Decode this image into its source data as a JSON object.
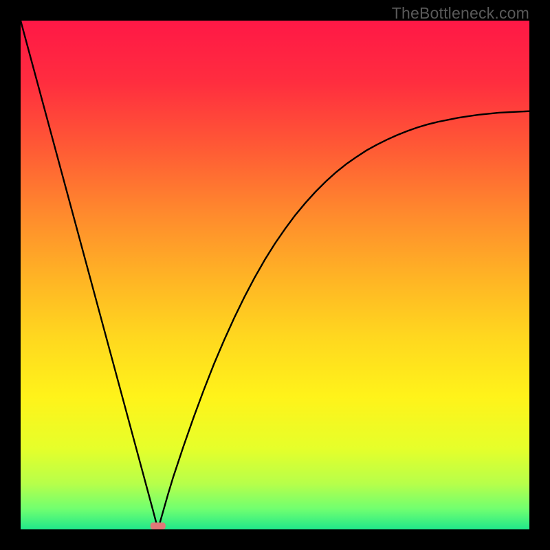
{
  "watermark": "TheBottleneck.com",
  "chart_data": {
    "type": "line",
    "title": "",
    "xlabel": "",
    "ylabel": "",
    "xlim": [
      0,
      100
    ],
    "ylim": [
      0,
      100
    ],
    "min_x": 27,
    "series": [
      {
        "name": "curve",
        "x": [
          0,
          2,
          4,
          6,
          8,
          10,
          12,
          14,
          16,
          18,
          20,
          22,
          24,
          25,
          26,
          27,
          28,
          29,
          30,
          32,
          34,
          36,
          38,
          40,
          42,
          44,
          46,
          48,
          50,
          52,
          54,
          56,
          58,
          60,
          62,
          64,
          66,
          68,
          70,
          72,
          74,
          76,
          78,
          80,
          82,
          84,
          86,
          88,
          90,
          92,
          94,
          96,
          98,
          100
        ],
        "y": [
          100,
          92.6,
          85.2,
          77.8,
          70.4,
          63.0,
          55.6,
          48.2,
          40.8,
          33.4,
          26.0,
          18.6,
          11.2,
          7.5,
          3.8,
          0.0,
          3.5,
          7.0,
          10.3,
          16.3,
          22.0,
          27.4,
          32.5,
          37.2,
          41.6,
          45.7,
          49.5,
          53.0,
          56.2,
          59.1,
          61.8,
          64.2,
          66.4,
          68.4,
          70.2,
          71.8,
          73.2,
          74.5,
          75.6,
          76.6,
          77.5,
          78.3,
          79.0,
          79.6,
          80.1,
          80.5,
          80.9,
          81.2,
          81.5,
          81.7,
          81.9,
          82.0,
          82.1,
          82.2
        ]
      }
    ],
    "marker": {
      "x": 27,
      "y": 0
    },
    "gradient_stops": [
      {
        "pos": 0.0,
        "color": "#ff1846"
      },
      {
        "pos": 0.12,
        "color": "#ff2d3f"
      },
      {
        "pos": 0.25,
        "color": "#ff5a35"
      },
      {
        "pos": 0.38,
        "color": "#ff8a2d"
      },
      {
        "pos": 0.5,
        "color": "#ffb225"
      },
      {
        "pos": 0.62,
        "color": "#ffd71f"
      },
      {
        "pos": 0.74,
        "color": "#fff31a"
      },
      {
        "pos": 0.84,
        "color": "#e6ff2a"
      },
      {
        "pos": 0.91,
        "color": "#b7ff4a"
      },
      {
        "pos": 0.96,
        "color": "#70ff70"
      },
      {
        "pos": 1.0,
        "color": "#20e88a"
      }
    ]
  }
}
